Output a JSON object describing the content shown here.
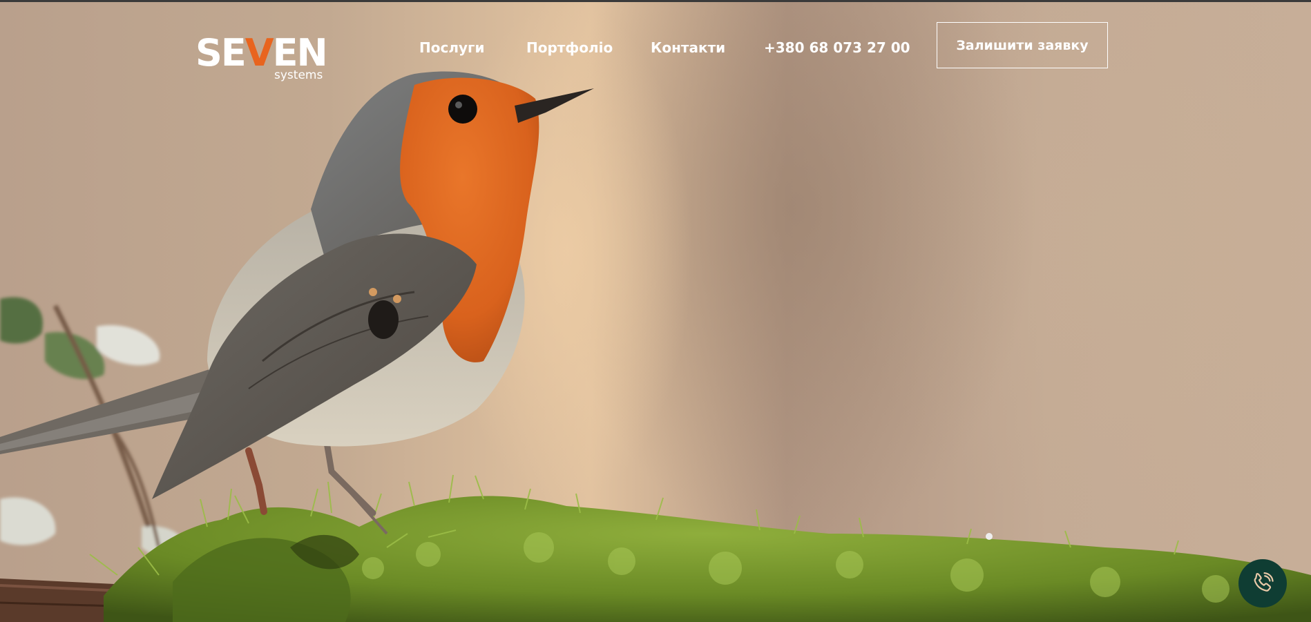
{
  "brand": {
    "logo_text_before": "SE",
    "logo_text_v": "V",
    "logo_text_after": "EN",
    "logo_subtitle": "systems",
    "accent_color": "#e8641e"
  },
  "nav": {
    "items": [
      {
        "label": "Послуги"
      },
      {
        "label": "Портфоліо"
      },
      {
        "label": "Контакти"
      },
      {
        "label": "+380 68 073 27 00"
      }
    ],
    "cta_label": "Залишити заявку"
  },
  "hero": {
    "image_subject": "robin-bird-on-moss"
  },
  "fab": {
    "icon": "phone-icon",
    "color": "#0f3d33"
  }
}
